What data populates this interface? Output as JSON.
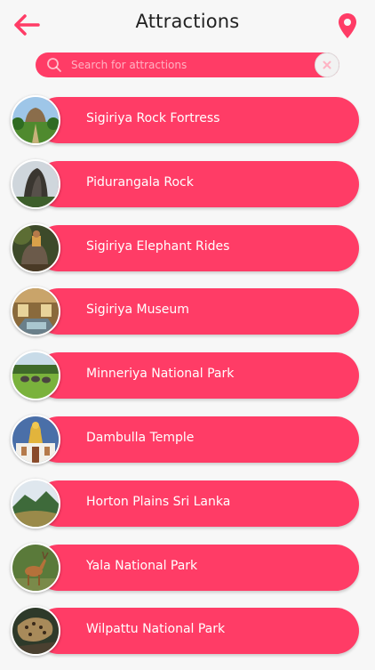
{
  "header": {
    "title": "Attractions",
    "back_icon": "back-arrow-icon",
    "location_icon": "map-pin-icon"
  },
  "search": {
    "placeholder": "Search for attractions",
    "value": "",
    "icon": "search-icon",
    "clear_icon": "close-icon"
  },
  "colors": {
    "accent": "#ff3c66",
    "background": "#f7f7f7",
    "title_text": "#222222",
    "item_text": "#ffffff"
  },
  "attractions": [
    {
      "label": "Sigiriya Rock Fortress",
      "image": "sigiriya-rock-fortress-photo"
    },
    {
      "label": "Pidurangala Rock",
      "image": "pidurangala-rock-photo"
    },
    {
      "label": "Sigiriya Elephant Rides",
      "image": "elephant-ride-photo"
    },
    {
      "label": "Sigiriya Museum",
      "image": "museum-interior-photo"
    },
    {
      "label": "Minneriya National Park",
      "image": "elephants-grassland-photo"
    },
    {
      "label": "Dambulla Temple",
      "image": "golden-buddha-temple-photo"
    },
    {
      "label": "Horton Plains Sri Lanka",
      "image": "mountain-plains-photo"
    },
    {
      "label": "Yala National Park",
      "image": "deer-photo"
    },
    {
      "label": "Wilpattu National Park",
      "image": "leopard-photo"
    }
  ]
}
